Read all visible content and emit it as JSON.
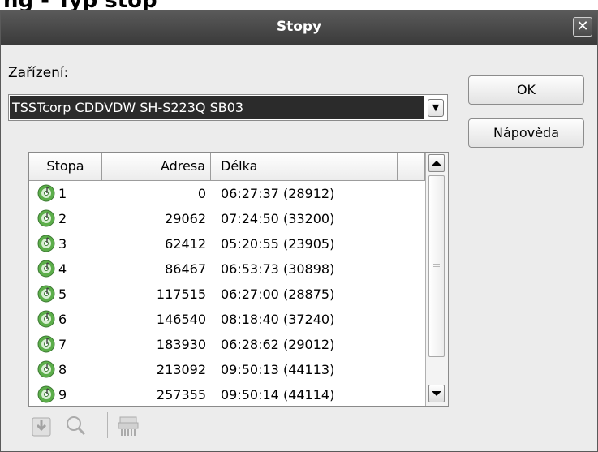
{
  "cropped_heading": "ng - Typ stop",
  "window": {
    "title": "Stopy",
    "close_glyph": "✕"
  },
  "device": {
    "label": "Zařízení:",
    "selected": "TSSTcorp CDDVDW SH-S223Q SB03"
  },
  "buttons": {
    "ok": "OK",
    "help": "Nápověda"
  },
  "tracks": {
    "columns": [
      "Stopa",
      "Adresa",
      "Délka"
    ],
    "rows": [
      {
        "stopa": "1",
        "adresa": "0",
        "delka": "06:27:37 (28912)"
      },
      {
        "stopa": "2",
        "adresa": "29062",
        "delka": "07:24:50 (33200)"
      },
      {
        "stopa": "3",
        "adresa": "62412",
        "delka": "05:20:55 (23905)"
      },
      {
        "stopa": "4",
        "adresa": "86467",
        "delka": "06:53:73 (30898)"
      },
      {
        "stopa": "5",
        "adresa": "117515",
        "delka": "06:27:00 (28875)"
      },
      {
        "stopa": "6",
        "adresa": "146540",
        "delka": "08:18:40 (37240)"
      },
      {
        "stopa": "7",
        "adresa": "183930",
        "delka": "06:28:62 (29012)"
      },
      {
        "stopa": "8",
        "adresa": "213092",
        "delka": "09:50:13 (44113)"
      },
      {
        "stopa": "9",
        "adresa": "257355",
        "delka": "09:50:14 (44114)"
      }
    ]
  },
  "toolbar": {
    "icons": [
      "save-track-icon",
      "preview-magnifier-icon",
      "shredder-icon"
    ]
  },
  "colors": {
    "titlebar": "#4a4a4a",
    "selection": "#2b2b2b",
    "disc_green": "#5cae4a"
  }
}
